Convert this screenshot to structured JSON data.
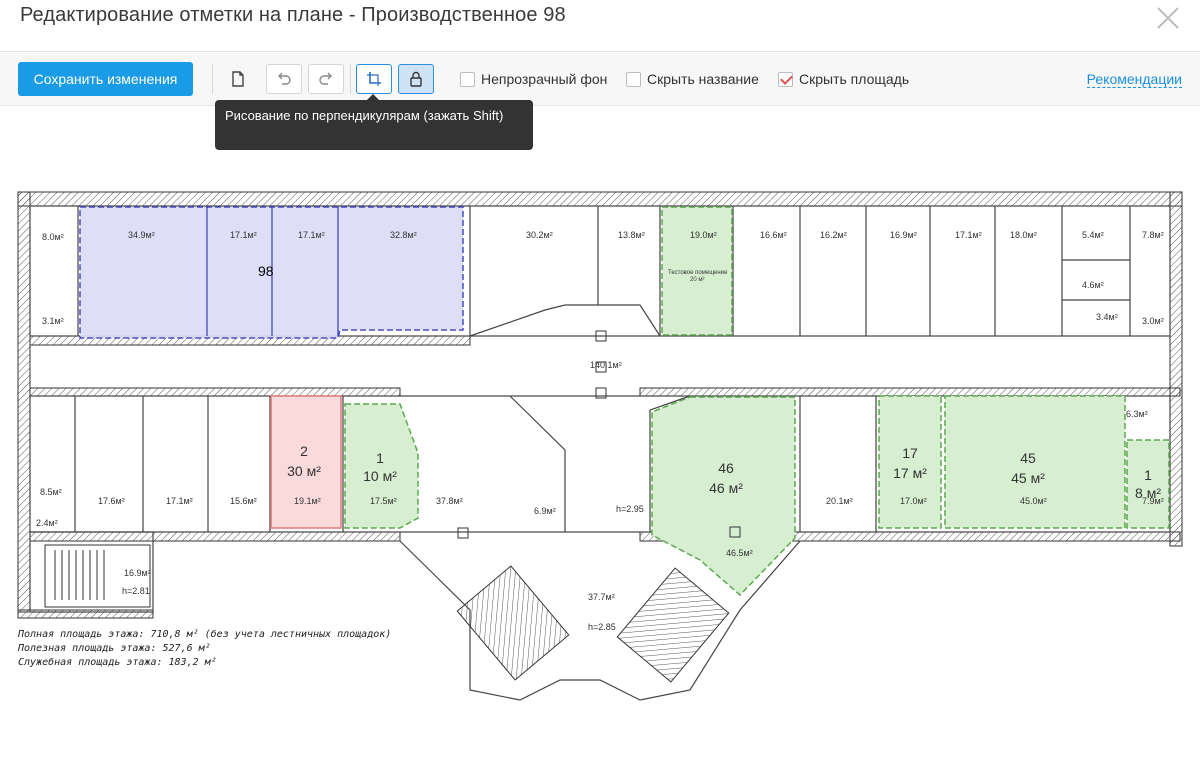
{
  "window": {
    "title": "Редактирование отметки на плане - Производственное 98"
  },
  "toolbar": {
    "save_label": "Сохранить изменения",
    "icons": {
      "new": "file-icon",
      "undo": "undo-icon",
      "redo": "redo-icon",
      "perpendicular": "perpendicular-draw-icon",
      "lock": "lock-icon"
    },
    "checkboxes": [
      {
        "label": "Непрозрачный фон",
        "checked": false
      },
      {
        "label": "Скрыть название",
        "checked": false
      },
      {
        "label": "Скрыть площадь",
        "checked": true
      }
    ],
    "recommendations": "Рекомендации"
  },
  "tooltip": {
    "text": "Рисование по перпендикулярам (зажать Shift)"
  },
  "plan": {
    "selected_label": "98",
    "rooms_top": [
      "8.0м²",
      "34.9м²",
      "17.1м²",
      "17.1м²",
      "32.8м²",
      "30.2м²",
      "13.8м²",
      "19.0м²",
      "16.6м²",
      "16.2м²",
      "16.9м²",
      "17.1м²",
      "18.0м²",
      "5.4м²",
      "7.8м²",
      "4.6м²",
      "3.4м²",
      "3.0м²",
      "3.1м²"
    ],
    "test_room_text": "Тестовое помещение",
    "test_room_sub": "20 м²",
    "corridor_area": "140.1м²",
    "rooms_bottom": [
      "8.5м²",
      "2.4м²",
      "17.6м²",
      "17.1м²",
      "15.6м²",
      "19.1м²",
      "17.5м²",
      "37.8м²",
      "6.9м²",
      "20.1м²",
      "17.0м²",
      "45.0м²",
      "7.9м²",
      "6.3м²",
      "16.9м²",
      "46.5м²"
    ],
    "heights": {
      "h1": "h=2.95",
      "h2": "h=2.85",
      "h3": "h=2.81"
    },
    "lobby_area": "37.7м²",
    "markers": [
      {
        "num": "2",
        "area": "30 м²",
        "color": "red"
      },
      {
        "num": "1",
        "area": "10 м²",
        "color": "green"
      },
      {
        "num": "46",
        "area": "46 м²",
        "color": "green"
      },
      {
        "num": "17",
        "area": "17 м²",
        "color": "green"
      },
      {
        "num": "45",
        "area": "45 м²",
        "color": "green"
      },
      {
        "num": "1",
        "area": "8 м²",
        "color": "green"
      }
    ],
    "legend": [
      "Полная площадь этажа: 710,8 м² (без учета лестничных площадок)",
      "Полезная площадь этажа: 527,6 м²",
      "Служебная площадь этажа: 183,2 м²"
    ]
  },
  "colors": {
    "accent": "#1a9be6",
    "blue_fill": "#dcdcf8",
    "blue_stroke": "#3a3fbf",
    "green_fill": "#d7efd0",
    "green_stroke": "#5aa94f",
    "red_fill": "#fadada",
    "red_stroke": "#e07a7a"
  }
}
